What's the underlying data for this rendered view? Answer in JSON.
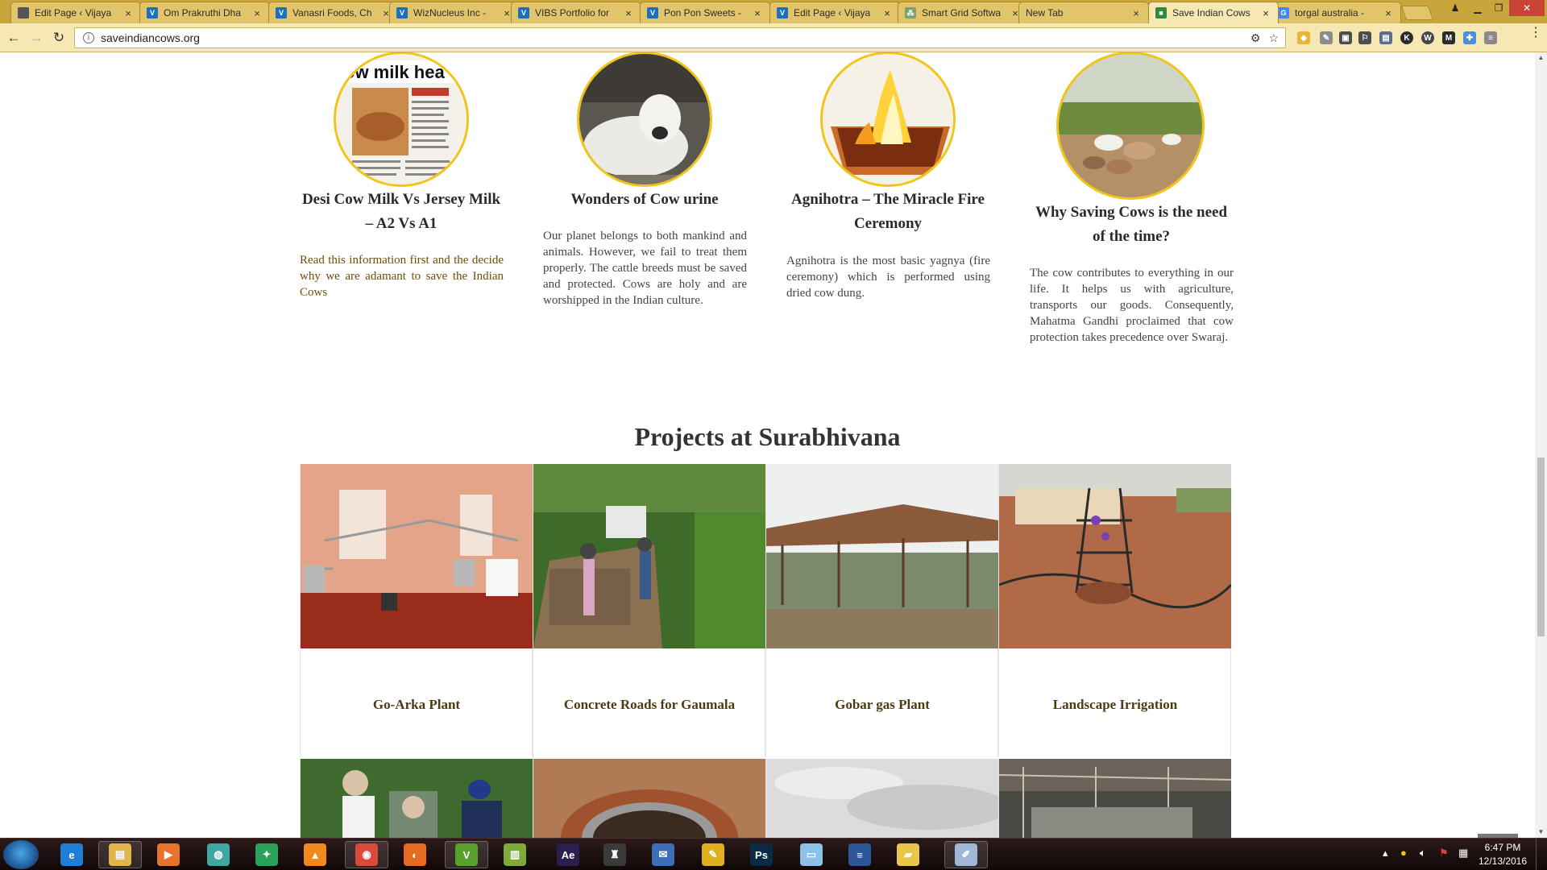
{
  "browser": {
    "tabs": [
      {
        "title": "Edit Page ‹ Vijaya",
        "favicon": "loading-spinner-icon",
        "color": "#555555",
        "glyph": ""
      },
      {
        "title": "Om Prakruthi Dha",
        "favicon": "v-logo-icon",
        "color": "#1e6fb8",
        "glyph": "V"
      },
      {
        "title": "Vanasri Foods, Ch",
        "favicon": "v-logo-icon",
        "color": "#1e6fb8",
        "glyph": "V"
      },
      {
        "title": "WizNucleus Inc - ",
        "favicon": "v-logo-icon",
        "color": "#1e6fb8",
        "glyph": "V"
      },
      {
        "title": "VIBS Portfolio for",
        "favicon": "v-logo-icon",
        "color": "#1e6fb8",
        "glyph": "V"
      },
      {
        "title": "Pon Pon Sweets - ",
        "favicon": "v-logo-icon",
        "color": "#1e6fb8",
        "glyph": "V"
      },
      {
        "title": "Edit Page ‹ Vijaya",
        "favicon": "v-logo-icon",
        "color": "#1e6fb8",
        "glyph": "V"
      },
      {
        "title": "Smart Grid Softwa",
        "favicon": "grid-icon",
        "color": "#7aa36b",
        "glyph": "⁂"
      },
      {
        "title": "New Tab",
        "favicon": "",
        "color": "",
        "glyph": ""
      },
      {
        "title": "Save Indian Cows",
        "favicon": "cow-site-icon",
        "color": "#2e8b3a",
        "glyph": "■"
      },
      {
        "title": "torgal australia - ",
        "favicon": "google-icon",
        "color": "#4285f4",
        "glyph": "G"
      }
    ],
    "active_tab_index": 9,
    "url": "saveindiancows.org",
    "theme_color": "#c9a63c"
  },
  "features": [
    {
      "title": "Desi Cow Milk Vs Jersey Milk – A2 Vs A1",
      "text": "Read this information first and the decide why we are adamant to save the Indian Cows",
      "text_color": "#6b4e0a",
      "image": "newspaper-cow-milk-health"
    },
    {
      "title": "Wonders of Cow urine",
      "text": "Our planet belongs to both mankind and animals. However, we fail to treat them properly. The cattle breeds must be saved and protected. Cows are holy and are worshipped in the Indian culture.",
      "text_color": "#444444",
      "image": "white-calf-lying"
    },
    {
      "title": "Agnihotra – The Miracle Fire Ceremony",
      "text": "Agnihotra is the most basic yagnya (fire ceremony) which is performed using dried cow dung.",
      "text_color": "#444444",
      "image": "fire-ceremony"
    },
    {
      "title": "Why Saving Cows is the need of the time?",
      "text": "The cow contributes to everything in our life. It helps us with agriculture, transports our goods. Consequently, Mahatma Gandhi proclaimed that cow protection takes precedence over Swaraj.",
      "text_color": "#444444",
      "image": "cows-herd-field"
    }
  ],
  "projects": {
    "heading": "Projects at Surabhivana",
    "items": [
      {
        "caption": "Go-Arka Plant",
        "image": "distillation-room"
      },
      {
        "caption": "Concrete Roads for Gaumala",
        "image": "workers-hillside"
      },
      {
        "caption": "Gobar gas Plant",
        "image": "metal-shed"
      },
      {
        "caption": "Landscape Irrigation",
        "image": "tree-guard-pipes"
      },
      {
        "caption": "",
        "image": "people-garden"
      },
      {
        "caption": "",
        "image": "brick-well"
      },
      {
        "caption": "",
        "image": "cloudy-sky"
      },
      {
        "caption": "",
        "image": "cattle-shed-interior"
      }
    ]
  },
  "back_to_top_icon": "chevron-up-icon",
  "taskbar": {
    "apps": [
      {
        "name": "ie-icon",
        "color": "#1f7fd6",
        "glyph": "e"
      },
      {
        "name": "file-explorer-icon",
        "color": "#e2b54a",
        "glyph": "▤"
      },
      {
        "name": "media-player-icon",
        "color": "#e8742b",
        "glyph": "▶"
      },
      {
        "name": "network-globe-icon",
        "color": "#3ea7a1",
        "glyph": "◍"
      },
      {
        "name": "green-app-icon",
        "color": "#2aa15a",
        "glyph": "✦"
      },
      {
        "name": "vlc-icon",
        "color": "#f08a1c",
        "glyph": "▲"
      },
      {
        "name": "chrome-icon",
        "color": "#d94a3b",
        "glyph": "◉"
      },
      {
        "name": "firefox-icon",
        "color": "#e66a1f",
        "glyph": "◐"
      },
      {
        "name": "green-v-app-icon",
        "color": "#5aa02c",
        "glyph": "V"
      },
      {
        "name": "chart-app-icon",
        "color": "#7dab3a",
        "glyph": "▥"
      },
      {
        "name": "after-effects-icon",
        "color": "#2a1f4f",
        "glyph": "Ae"
      },
      {
        "name": "inkscape-icon",
        "color": "#3a3a3a",
        "glyph": "♜"
      },
      {
        "name": "mail-client-icon",
        "color": "#3b6fb8",
        "glyph": "✉"
      },
      {
        "name": "pencil-app-icon",
        "color": "#e0b020",
        "glyph": "✎"
      },
      {
        "name": "photoshop-icon",
        "color": "#0b2a45",
        "glyph": "Ps"
      },
      {
        "name": "notes-app-icon",
        "color": "#8cc1e8",
        "glyph": "▭"
      },
      {
        "name": "word-doc-icon",
        "color": "#2b5797",
        "glyph": "≡"
      },
      {
        "name": "folder-icon",
        "color": "#e8c64a",
        "glyph": "▰"
      },
      {
        "name": "paint-icon",
        "color": "#9fb8d8",
        "glyph": "✐"
      }
    ],
    "time": "6:47 PM",
    "date": "12/13/2016"
  }
}
